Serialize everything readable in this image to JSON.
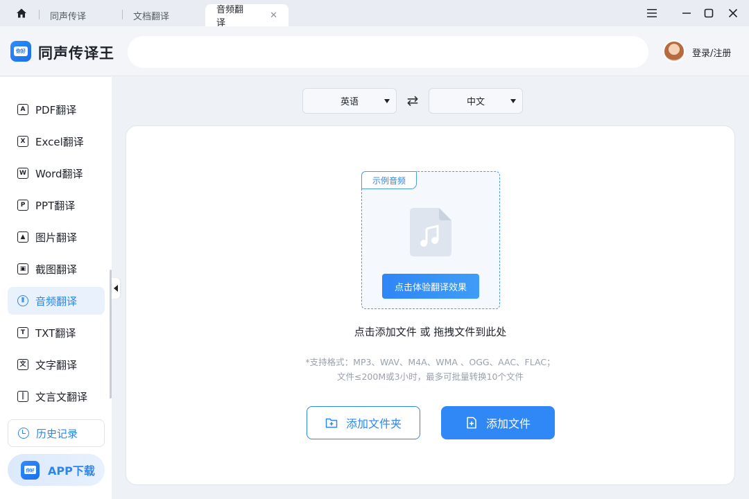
{
  "tabs": [
    {
      "label": "同声传译"
    },
    {
      "label": "文档翻译"
    },
    {
      "label": "音频翻译"
    }
  ],
  "header": {
    "app_title": "同声传译王",
    "logo_text": "你好",
    "search_value": "",
    "login_label": "登录/注册"
  },
  "sidebar": {
    "items": [
      {
        "label": "PDF翻译",
        "icon": "A"
      },
      {
        "label": "Excel翻译",
        "icon": "X"
      },
      {
        "label": "Word翻译",
        "icon": "W"
      },
      {
        "label": "PPT翻译",
        "icon": "P"
      },
      {
        "label": "图片翻译",
        "icon": "▲"
      },
      {
        "label": "截图翻译",
        "icon": "▣"
      },
      {
        "label": "音频翻译",
        "icon": "⦀"
      },
      {
        "label": "TXT翻译",
        "icon": "T"
      },
      {
        "label": "文字翻译",
        "icon": "文"
      },
      {
        "label": "文言文翻译",
        "icon": "║"
      }
    ],
    "active_label": "音频翻译",
    "history_label": "历史记录",
    "app_download_label": "APP下载"
  },
  "language": {
    "source": "英语",
    "target": "中文",
    "swap_icon": "⇄"
  },
  "upload": {
    "sample_tag": "示例音频",
    "try_button": "点击体验翻译效果",
    "drop_hint": "点击添加文件 或 拖拽文件到此处",
    "formats_line1": "*支持格式：MP3、WAV、M4A、WMA 、OGG、AAC、FLAC；",
    "formats_line2": "文件≤200M或3小时，最多可批量转换10个文件",
    "add_folder_label": "添加文件夹",
    "add_file_label": "添加文件"
  },
  "colors": {
    "accent": "#2b86f3",
    "active_bg": "#e8f1fc",
    "app_bg": "#eef1f6"
  },
  "icons": {
    "home": "home-icon",
    "menu": "menu-icon",
    "minimize": "minimize-icon",
    "maximize": "maximize-icon",
    "close": "close-icon",
    "music_file": "music-file-icon",
    "folder_add": "folder-add-icon",
    "file_add": "file-add-icon",
    "history": "clock-icon"
  }
}
